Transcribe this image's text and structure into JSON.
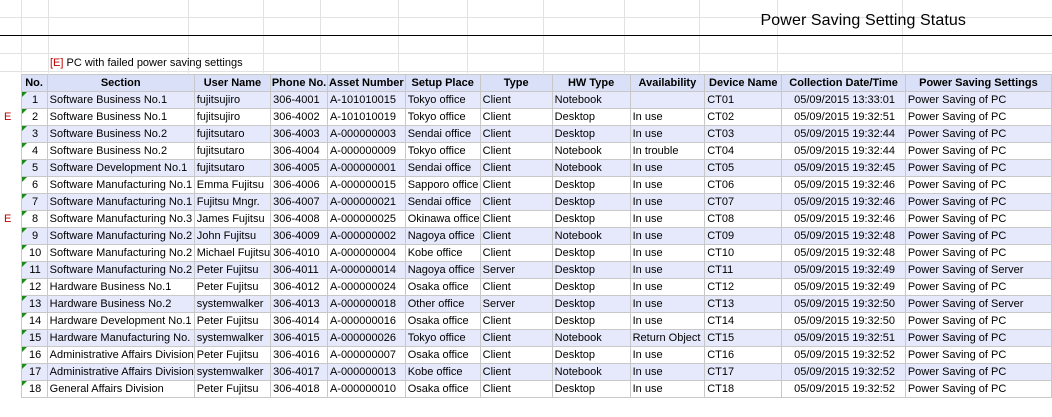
{
  "report": {
    "title": "Power Saving Setting Status",
    "legend_mark": "[E]",
    "legend_text": " PC with failed power saving settings"
  },
  "table": {
    "headers": [
      "No.",
      "Section",
      "User Name",
      "Phone No.",
      "Asset Number",
      "Setup Place",
      "Type",
      "HW Type",
      "Availability",
      "Device Name",
      "Collection Date/Time",
      "Power Saving Settings"
    ],
    "rows": [
      {
        "flag": "",
        "no": "1",
        "section": "Software Business No.1",
        "user": "fujitsujiro",
        "phone": "306-4001",
        "asset": "A-101010015",
        "place": "Tokyo office",
        "type": "Client",
        "hw": "Notebook",
        "avail": "",
        "device": "CT01",
        "date": "05/09/2015 13:33:01",
        "power": "Power Saving of PC"
      },
      {
        "flag": "E",
        "no": "2",
        "section": "Software Business No.1",
        "user": "fujitsujiro",
        "phone": "306-4002",
        "asset": "A-101010019",
        "place": "Tokyo office",
        "type": "Client",
        "hw": "Desktop",
        "avail": "In use",
        "device": "CT02",
        "date": "05/09/2015 19:32:51",
        "power": "Power Saving of PC"
      },
      {
        "flag": "",
        "no": "3",
        "section": "Software Business No.2",
        "user": "fujitsutaro",
        "phone": "306-4003",
        "asset": "A-000000003",
        "place": "Sendai office",
        "type": "Client",
        "hw": "Desktop",
        "avail": "In use",
        "device": "CT03",
        "date": "05/09/2015 19:32:44",
        "power": "Power Saving of PC"
      },
      {
        "flag": "",
        "no": "4",
        "section": "Software Business No.2",
        "user": "fujitsutaro",
        "phone": "306-4004",
        "asset": "A-000000009",
        "place": "Tokyo office",
        "type": "Client",
        "hw": "Notebook",
        "avail": "In trouble",
        "device": "CT04",
        "date": "05/09/2015 19:32:44",
        "power": "Power Saving of PC"
      },
      {
        "flag": "",
        "no": "5",
        "section": "Software Development No.1",
        "user": "fujitsutaro",
        "phone": "306-4005",
        "asset": "A-000000001",
        "place": "Sendai office",
        "type": "Client",
        "hw": "Notebook",
        "avail": "In use",
        "device": "CT05",
        "date": "05/09/2015 19:32:45",
        "power": "Power Saving of PC"
      },
      {
        "flag": "",
        "no": "6",
        "section": "Software Manufacturing No.1",
        "user": "Emma Fujitsu",
        "phone": "306-4006",
        "asset": "A-000000015",
        "place": "Sapporo office",
        "type": "Client",
        "hw": "Desktop",
        "avail": "In use",
        "device": "CT06",
        "date": "05/09/2015 19:32:46",
        "power": "Power Saving of PC"
      },
      {
        "flag": "",
        "no": "7",
        "section": "Software Manufacturing No.1",
        "user": "Fujitsu Mngr.",
        "phone": "306-4007",
        "asset": "A-000000021",
        "place": "Sendai office",
        "type": "Client",
        "hw": "Desktop",
        "avail": "In use",
        "device": "CT07",
        "date": "05/09/2015 19:32:46",
        "power": "Power Saving of PC"
      },
      {
        "flag": "E",
        "no": "8",
        "section": "Software Manufacturing No.3",
        "user": "James Fujitsu",
        "phone": "306-4008",
        "asset": "A-000000025",
        "place": "Okinawa office",
        "type": "Client",
        "hw": "Desktop",
        "avail": "In use",
        "device": "CT08",
        "date": "05/09/2015 19:32:46",
        "power": "Power Saving of PC"
      },
      {
        "flag": "",
        "no": "9",
        "section": "Software Manufacturing No.2",
        "user": "John Fujitsu",
        "phone": "306-4009",
        "asset": "A-000000002",
        "place": "Nagoya office",
        "type": "Client",
        "hw": "Notebook",
        "avail": "In use",
        "device": "CT09",
        "date": "05/09/2015 19:32:48",
        "power": "Power Saving of PC"
      },
      {
        "flag": "",
        "no": "10",
        "section": "Software Manufacturing No.2",
        "user": "Michael Fujitsu",
        "phone": "306-4010",
        "asset": "A-000000004",
        "place": "Kobe office",
        "type": "Client",
        "hw": "Desktop",
        "avail": "In use",
        "device": "CT10",
        "date": "05/09/2015 19:32:48",
        "power": "Power Saving of PC"
      },
      {
        "flag": "",
        "no": "11",
        "section": "Software Manufacturing No.2",
        "user": "Peter Fujitsu",
        "phone": "306-4011",
        "asset": "A-000000014",
        "place": "Nagoya office",
        "type": "Server",
        "hw": "Desktop",
        "avail": "In use",
        "device": "CT11",
        "date": "05/09/2015 19:32:49",
        "power": "Power Saving of Server"
      },
      {
        "flag": "",
        "no": "12",
        "section": "Hardware Business No.1",
        "user": "Peter Fujitsu",
        "phone": "306-4012",
        "asset": "A-000000024",
        "place": "Osaka office",
        "type": "Client",
        "hw": "Desktop",
        "avail": "In use",
        "device": "CT12",
        "date": "05/09/2015 19:32:49",
        "power": "Power Saving of PC"
      },
      {
        "flag": "",
        "no": "13",
        "section": "Hardware Business No.2",
        "user": "systemwalker",
        "phone": "306-4013",
        "asset": "A-000000018",
        "place": "Other office",
        "type": "Server",
        "hw": "Desktop",
        "avail": "In use",
        "device": "CT13",
        "date": "05/09/2015 19:32:50",
        "power": "Power Saving of Server"
      },
      {
        "flag": "",
        "no": "14",
        "section": "Hardware Development No.1",
        "user": "Peter Fujitsu",
        "phone": "306-4014",
        "asset": "A-000000016",
        "place": "Osaka office",
        "type": "Client",
        "hw": "Desktop",
        "avail": "In use",
        "device": "CT14",
        "date": "05/09/2015 19:32:50",
        "power": "Power Saving of PC"
      },
      {
        "flag": "",
        "no": "15",
        "section": "Hardware Manufacturing No.",
        "user": "systemwalker",
        "phone": "306-4015",
        "asset": "A-000000026",
        "place": "Tokyo office",
        "type": "Client",
        "hw": "Notebook",
        "avail": "Return Object",
        "device": "CT15",
        "date": "05/09/2015 19:32:51",
        "power": "Power Saving of PC"
      },
      {
        "flag": "",
        "no": "16",
        "section": "Administrative Affairs Division",
        "user": "Peter Fujitsu",
        "phone": "306-4016",
        "asset": "A-000000007",
        "place": "Osaka office",
        "type": "Client",
        "hw": "Desktop",
        "avail": "In use",
        "device": "CT16",
        "date": "05/09/2015 19:32:52",
        "power": "Power Saving of PC"
      },
      {
        "flag": "",
        "no": "17",
        "section": "Administrative Affairs Division",
        "user": "systemwalker",
        "phone": "306-4017",
        "asset": "A-000000013",
        "place": "Kobe office",
        "type": "Client",
        "hw": "Notebook",
        "avail": "In use",
        "device": "CT17",
        "date": "05/09/2015 19:32:52",
        "power": "Power Saving of PC"
      },
      {
        "flag": "",
        "no": "18",
        "section": "General Affairs Division",
        "user": "Peter Fujitsu",
        "phone": "306-4018",
        "asset": "A-000000010",
        "place": "Osaka office",
        "type": "Client",
        "hw": "Desktop",
        "avail": "In use",
        "device": "CT18",
        "date": "05/09/2015 19:32:52",
        "power": "Power Saving of PC"
      }
    ]
  },
  "colors": {
    "header_bg": "#d9e0f7",
    "stripe_bg": "#e6e9fb",
    "error_mark": "#c00000",
    "comment_marker": "#1a8a1a"
  }
}
